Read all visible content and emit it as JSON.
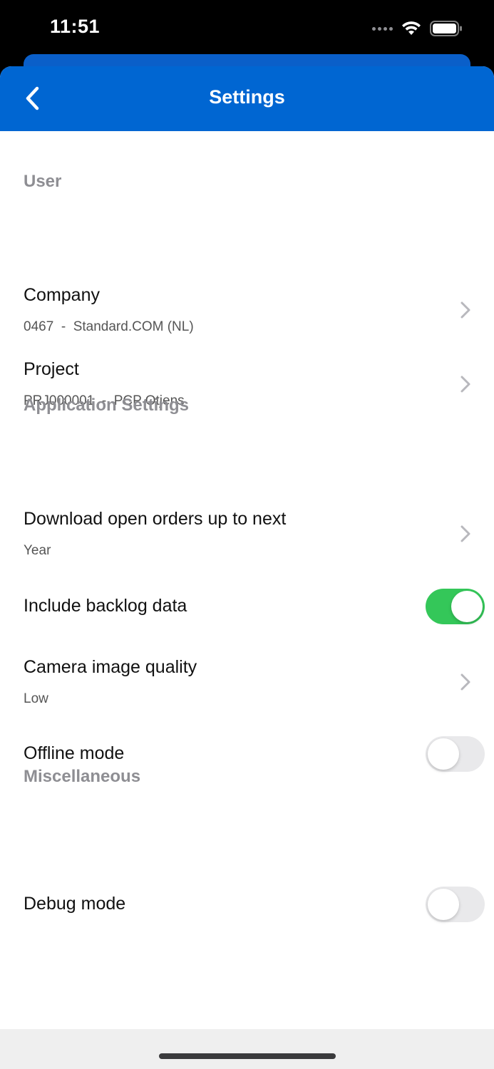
{
  "status_bar": {
    "time": "11:51",
    "icons": [
      "signal-dots-icon",
      "wifi-icon",
      "battery-icon"
    ]
  },
  "header": {
    "title": "Settings",
    "back_icon": "chevron-left-icon",
    "background_color": "#0066d2"
  },
  "sections": {
    "user": {
      "title": "User",
      "company": {
        "label": "Company",
        "value": "0467  -  Standard.COM (NL)"
      },
      "project": {
        "label": "Project",
        "value": "PRJ000001  -  PCP Otjens"
      }
    },
    "application": {
      "title": "Application Settings",
      "download": {
        "label": "Download open orders up to next",
        "value": "Year"
      },
      "backlog": {
        "label": "Include backlog data",
        "enabled": true
      },
      "camera": {
        "label": "Camera image quality",
        "value": "Low"
      },
      "offline": {
        "label": "Offline mode",
        "enabled": false
      }
    },
    "misc": {
      "title": "Miscellaneous",
      "debug": {
        "label": "Debug mode",
        "enabled": false
      }
    }
  },
  "colors": {
    "toggle_on": "#34c759",
    "toggle_off": "#e9e9eb",
    "section_header": "#8e8e93"
  }
}
